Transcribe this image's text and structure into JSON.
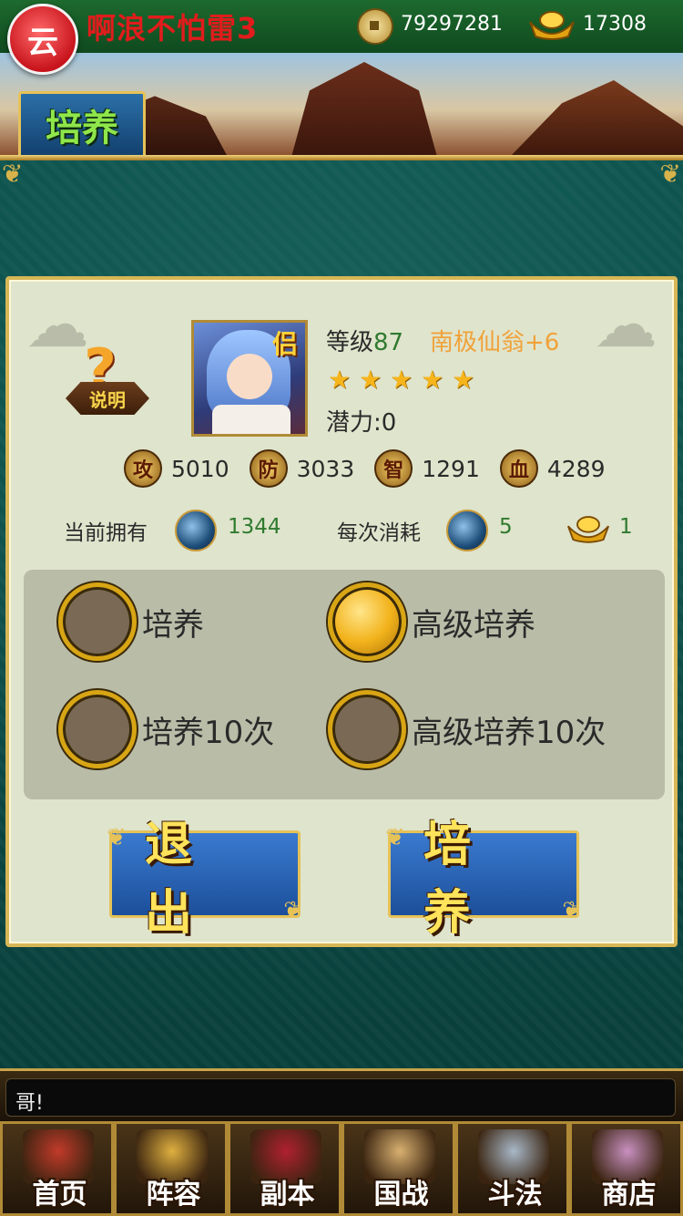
{
  "header": {
    "logo_glyph": "云",
    "player_name": "啊浪不怕雷3",
    "coins": "79297281",
    "gold": "17308",
    "page_title": "培养"
  },
  "hero": {
    "help_label": "说明",
    "portrait_badge": "侣",
    "level_label": "等级",
    "level": "87",
    "name": "南极仙翁+6",
    "stars": 5,
    "potential": "潜力:0",
    "stats": [
      {
        "icon": "攻",
        "value": "5010"
      },
      {
        "icon": "防",
        "value": "3033"
      },
      {
        "icon": "智",
        "value": "1291"
      },
      {
        "icon": "血",
        "value": "4289"
      }
    ]
  },
  "cost": {
    "owned_label": "当前拥有",
    "owned_value": "1344",
    "per_label": "每次消耗",
    "per_value": "5",
    "gold_value": "1"
  },
  "options": [
    {
      "label": "培养",
      "selected": false
    },
    {
      "label": "高级培养",
      "selected": true
    },
    {
      "label": "培养10次",
      "selected": false
    },
    {
      "label": "高级培养10次",
      "selected": false
    }
  ],
  "buttons": {
    "exit": "退出",
    "train": "培养"
  },
  "chat": {
    "text": "哥!"
  },
  "nav": [
    {
      "label": "首页",
      "color": "#c23a2a"
    },
    {
      "label": "阵容",
      "color": "#e0b040"
    },
    {
      "label": "副本",
      "color": "#b02030"
    },
    {
      "label": "国战",
      "color": "#d8b070"
    },
    {
      "label": "斗法",
      "color": "#a8b8c8"
    },
    {
      "label": "商店",
      "color": "#c890c0"
    }
  ]
}
